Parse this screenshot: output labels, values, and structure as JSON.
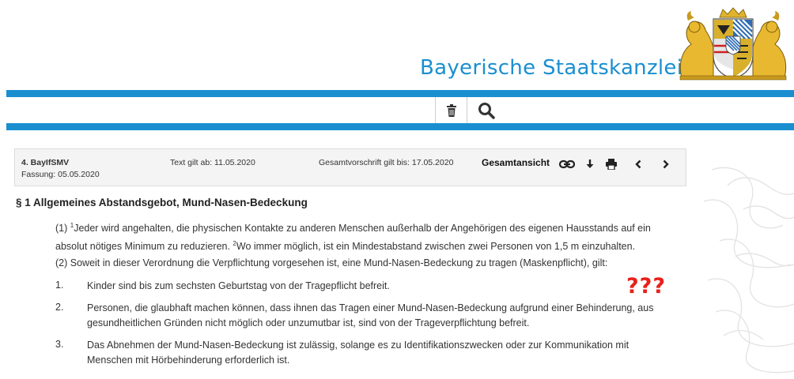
{
  "header": {
    "site_title": "Bayerische Staatskanzlei",
    "brand_color": "#1a8fd0",
    "logo_icon": "bavarian-coat-of-arms"
  },
  "search": {
    "value": "",
    "placeholder": "",
    "clear_icon": "trash-icon",
    "search_icon": "magnifier-icon"
  },
  "infobox": {
    "law": "4. BayIfSMV",
    "fassung": "Fassung: 05.05.2020",
    "text_gilt_ab": "Text gilt ab: 11.05.2020",
    "gesamtvorschrift": "Gesamtvorschrift gilt bis: 17.05.2020",
    "view_label": "Gesamtansicht",
    "icons": [
      "link-icon",
      "download-icon",
      "print-icon",
      "previous-icon",
      "next-icon"
    ]
  },
  "section": {
    "title": "§ 1  Allgemeines Abstandsgebot, Mund-Nasen-Bedeckung",
    "p1": {
      "prefix": "(1) ",
      "sup1": "1",
      "s1": "Jeder wird angehalten, die physischen Kontakte zu anderen Menschen außerhalb der Angehörigen des eigenen Hausstands auf ein absolut nötiges Minimum zu reduzieren. ",
      "sup2": "2",
      "s2": "Wo immer möglich, ist ein Mindestabstand zwischen zwei Personen von 1,5 m einzuhalten."
    },
    "p2": "(2) Soweit in dieser Verordnung die Verpflichtung vorgesehen ist, eine Mund-Nasen-Bedeckung zu tragen (Maskenpflicht), gilt:",
    "items": [
      {
        "num": "1.",
        "text": "Kinder sind bis zum sechsten Geburtstag von der Tragepflicht befreit."
      },
      {
        "num": "2.",
        "text": "Personen, die glaubhaft machen können, dass ihnen das Tragen einer Mund-Nasen-Bedeckung aufgrund einer Behinderung, aus gesundheitlichen Gründen nicht möglich oder unzumutbar ist, sind von der Trageverpflichtung befreit."
      },
      {
        "num": "3.",
        "text": "Das Abnehmen der Mund-Nasen-Bedeckung ist zulässig, solange es zu Identifikationszwecken oder zur Kommunikation mit Menschen mit Hörbehinderung erforderlich ist."
      }
    ]
  },
  "annotation": {
    "text": "???",
    "color": "#e8201b"
  }
}
